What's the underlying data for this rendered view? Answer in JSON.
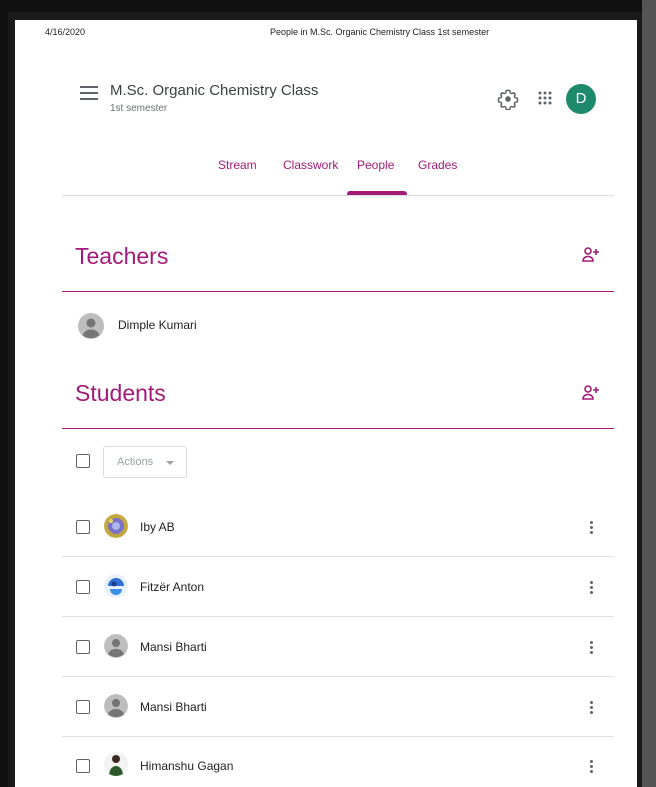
{
  "print_header": {
    "date": "4/16/2020",
    "title": "People in M.Sc. Organic Chemistry Class 1st semester"
  },
  "app_bar": {
    "class_name": "M.Sc. Organic Chemistry Class",
    "section": "1st semester",
    "account_initial": "D"
  },
  "tabs": [
    {
      "label": "Stream"
    },
    {
      "label": "Classwork"
    },
    {
      "label": "People",
      "active": true
    },
    {
      "label": "Grades"
    }
  ],
  "teachers": {
    "title": "Teachers",
    "list": [
      {
        "name": "Dimple Kumari"
      }
    ]
  },
  "students": {
    "title": "Students",
    "actions_label": "Actions",
    "list": [
      {
        "name": "Iby AB"
      },
      {
        "name": "Fitzër Anton"
      },
      {
        "name": "Mansi Bharti"
      },
      {
        "name": "Mansi Bharti"
      },
      {
        "name": "Himanshu Gagan"
      }
    ]
  },
  "colors": {
    "accent": "#a31a78",
    "avatar": "#1e8a6b"
  }
}
